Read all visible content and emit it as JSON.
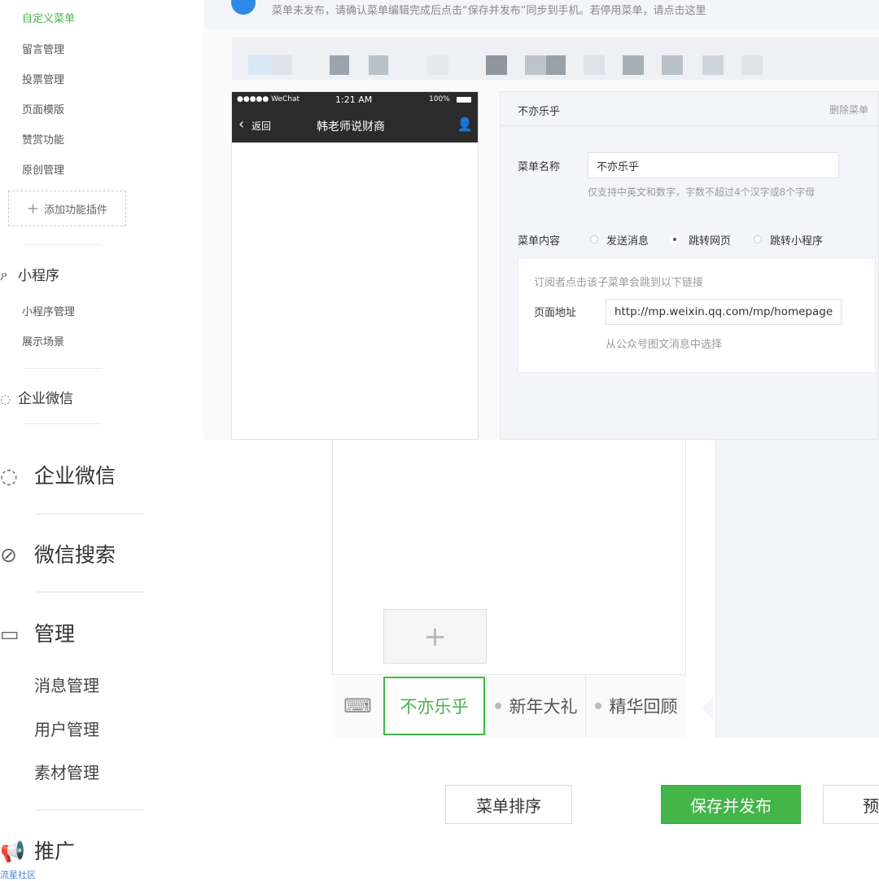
{
  "notice": {
    "text": "菜单未发布，请确认菜单编辑完成后点击“保存并发布”同步到手机。若停用菜单，请点击这里"
  },
  "small_sidebar": {
    "items_top": [
      "自定义菜单",
      "留言管理",
      "投票管理",
      "页面模版",
      "赞赏功能",
      "原创管理"
    ],
    "add_plugin": "添加功能插件",
    "mini_program": {
      "title": "小程序",
      "items": [
        "小程序管理",
        "展示场景"
      ]
    },
    "enterprise": "企业微信"
  },
  "phone": {
    "carrier": "●●●●● WeChat",
    "time": "1:21 AM",
    "battery": "100%",
    "back": "返回",
    "title": "韩老师说财商"
  },
  "editor": {
    "menu_title": "不亦乐乎",
    "delete_menu": "删除菜单",
    "name_label": "菜单名称",
    "name_value": "不亦乐乎",
    "name_hint": "仅支持中英文和数字，字数不超过4个汉字或8个字母",
    "content_label": "菜单内容",
    "options": [
      "发送消息",
      "跳转网页",
      "跳转小程序"
    ],
    "selected_option": "跳转网页",
    "link_hint": "订阅者点击该子菜单会跳到以下链接",
    "url_label": "页面地址",
    "url_value": "http://mp.weixin.qq.com/mp/homepage",
    "choose_from": "从公众号图文消息中选择"
  },
  "big_sidebar": {
    "enterprise": "企业微信",
    "search": "微信搜索",
    "manage": {
      "title": "管理",
      "items": [
        "消息管理",
        "用户管理",
        "素材管理"
      ]
    },
    "promote": "推广"
  },
  "menu_bar": {
    "add": "+",
    "tabs": [
      "不亦乐乎",
      "新年大礼",
      "精华回顾"
    ]
  },
  "buttons": {
    "sort": "菜单排序",
    "save_publish": "保存并发布",
    "preview_partial": "预"
  },
  "watermark": "流星社区",
  "colors": {
    "accent": "#44b549",
    "info": "#2e8ae6",
    "phone_bar": "#2b2b2b"
  }
}
